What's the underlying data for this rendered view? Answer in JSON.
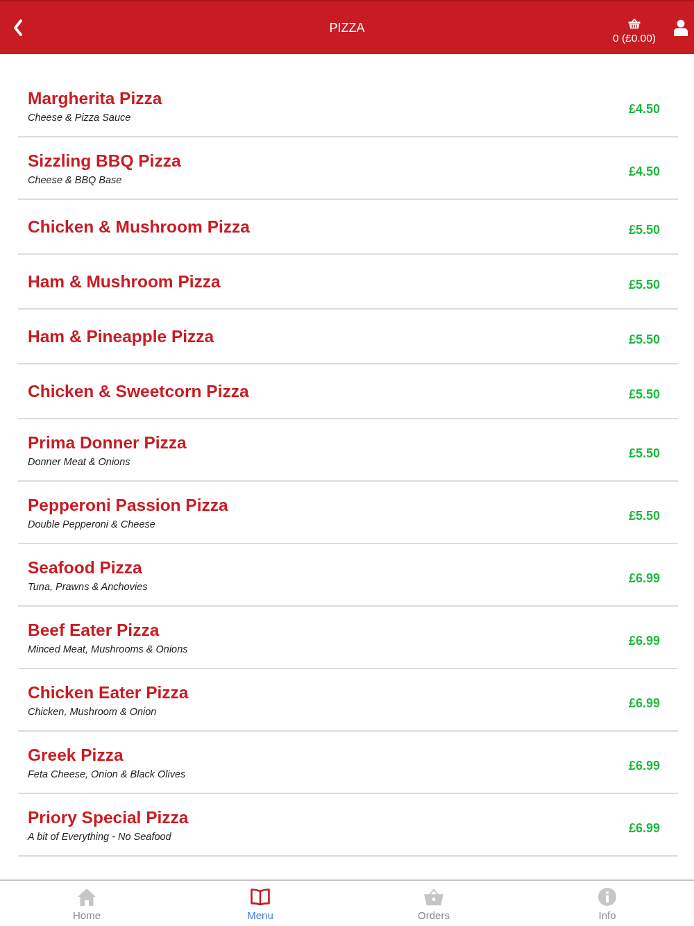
{
  "header": {
    "title": "PIZZA",
    "basket_summary": "0 (£0.00)"
  },
  "menu_items": [
    {
      "name": "Margherita Pizza",
      "description": "Cheese & Pizza Sauce",
      "price": "£4.50"
    },
    {
      "name": "Sizzling BBQ Pizza",
      "description": "Cheese & BBQ Base",
      "price": "£4.50"
    },
    {
      "name": "Chicken & Mushroom Pizza",
      "price": "£5.50"
    },
    {
      "name": "Ham & Mushroom Pizza",
      "price": "£5.50"
    },
    {
      "name": "Ham & Pineapple Pizza",
      "price": "£5.50"
    },
    {
      "name": "Chicken & Sweetcorn Pizza",
      "price": "£5.50"
    },
    {
      "name": "Prima Donner Pizza",
      "description": "Donner Meat & Onions",
      "price": "£5.50"
    },
    {
      "name": "Pepperoni Passion Pizza",
      "description": "Double Pepperoni & Cheese",
      "price": "£5.50"
    },
    {
      "name": "Seafood Pizza",
      "description": "Tuna, Prawns & Anchovies",
      "price": "£6.99"
    },
    {
      "name": "Beef Eater Pizza",
      "description": "Minced Meat, Mushrooms & Onions",
      "price": "£6.99"
    },
    {
      "name": "Chicken Eater Pizza",
      "description": "Chicken, Mushroom & Onion",
      "price": "£6.99"
    },
    {
      "name": "Greek Pizza",
      "description": "Feta Cheese, Onion & Black Olives",
      "price": "£6.99"
    },
    {
      "name": "Priory Special Pizza",
      "description": "A bit of Everything - No Seafood",
      "price": "£6.99"
    }
  ],
  "bottom_nav": [
    {
      "kind": "home",
      "label": "Home",
      "selected": false
    },
    {
      "kind": "menu",
      "label": "Menu",
      "selected": true
    },
    {
      "kind": "orders",
      "label": "Orders",
      "selected": false
    },
    {
      "kind": "info",
      "label": "Info",
      "selected": false
    }
  ]
}
